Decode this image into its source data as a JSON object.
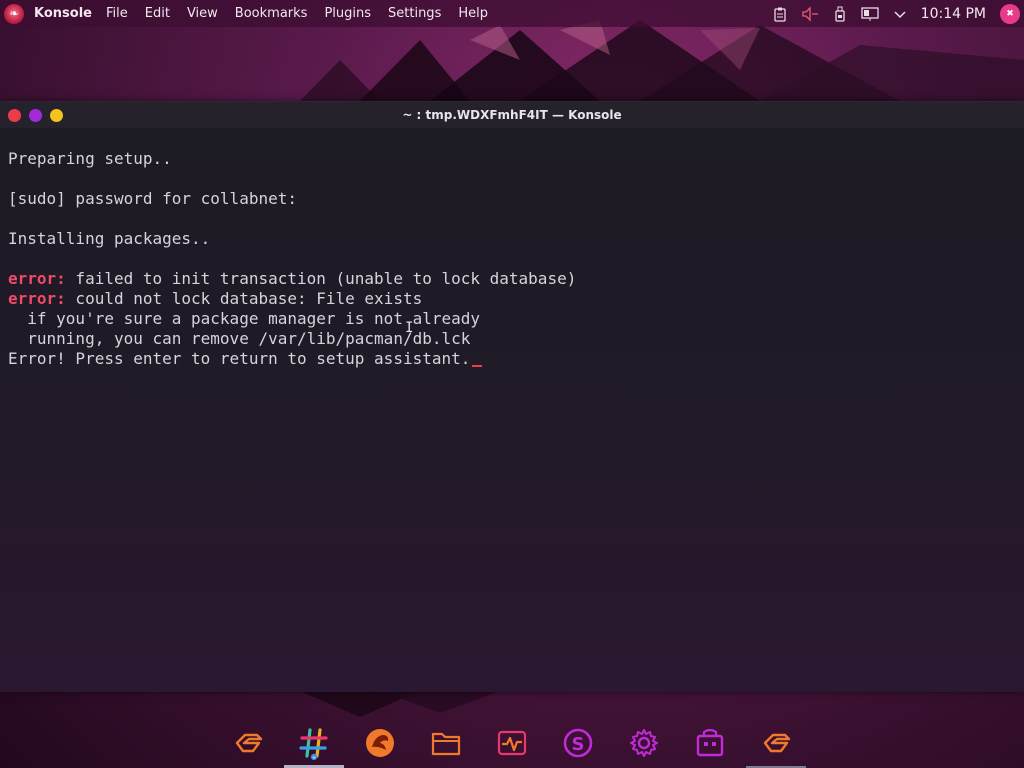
{
  "top_panel": {
    "app_name": "Konsole",
    "menu": [
      "File",
      "Edit",
      "View",
      "Bookmarks",
      "Plugins",
      "Settings",
      "Help"
    ],
    "clock": "10:14 PM",
    "tray_icons": [
      "clipboard-icon",
      "volume-muted-icon",
      "usb-drive-icon",
      "network-icon",
      "chevron-down-icon",
      "user-avatar-icon"
    ]
  },
  "window": {
    "title": "~ : tmp.WDXFmhF4IT — Konsole",
    "lines": [
      {
        "prefix": "",
        "text": "Preparing setup.."
      },
      {
        "prefix": "",
        "text": ""
      },
      {
        "prefix": "",
        "text": "[sudo] password for collabnet:"
      },
      {
        "prefix": "",
        "text": ""
      },
      {
        "prefix": "",
        "text": "Installing packages.."
      },
      {
        "prefix": "",
        "text": ""
      },
      {
        "prefix": "error:",
        "text": " failed to init transaction (unable to lock database)"
      },
      {
        "prefix": "error:",
        "text": " could not lock database: File exists"
      },
      {
        "prefix": "",
        "text": "  if you're sure a package manager is not already"
      },
      {
        "prefix": "",
        "text": "  running, you can remove /var/lib/pacman/db.lck"
      },
      {
        "prefix": "",
        "text": "Error! Press enter to return to setup assistant."
      }
    ]
  },
  "dock": {
    "items": [
      {
        "name": "garuda-welcome-icon",
        "state": ""
      },
      {
        "name": "hashtag-chat-icon",
        "state": "active"
      },
      {
        "name": "garuda-dragon-icon",
        "state": ""
      },
      {
        "name": "file-manager-icon",
        "state": ""
      },
      {
        "name": "system-monitor-icon",
        "state": ""
      },
      {
        "name": "snapper-tools-icon",
        "state": ""
      },
      {
        "name": "settings-gear-icon",
        "state": ""
      },
      {
        "name": "software-store-icon",
        "state": ""
      },
      {
        "name": "garuda-assistant-icon",
        "state": "running"
      }
    ]
  },
  "colors": {
    "error": "#f04a6a",
    "terminal_text": "#d7d3dc",
    "close": "#ee3b4a",
    "minimize": "#a22ad8",
    "maximize": "#f4c31c",
    "dock_orange": "#f07a2a",
    "dock_magenta": "#c02ad8"
  }
}
